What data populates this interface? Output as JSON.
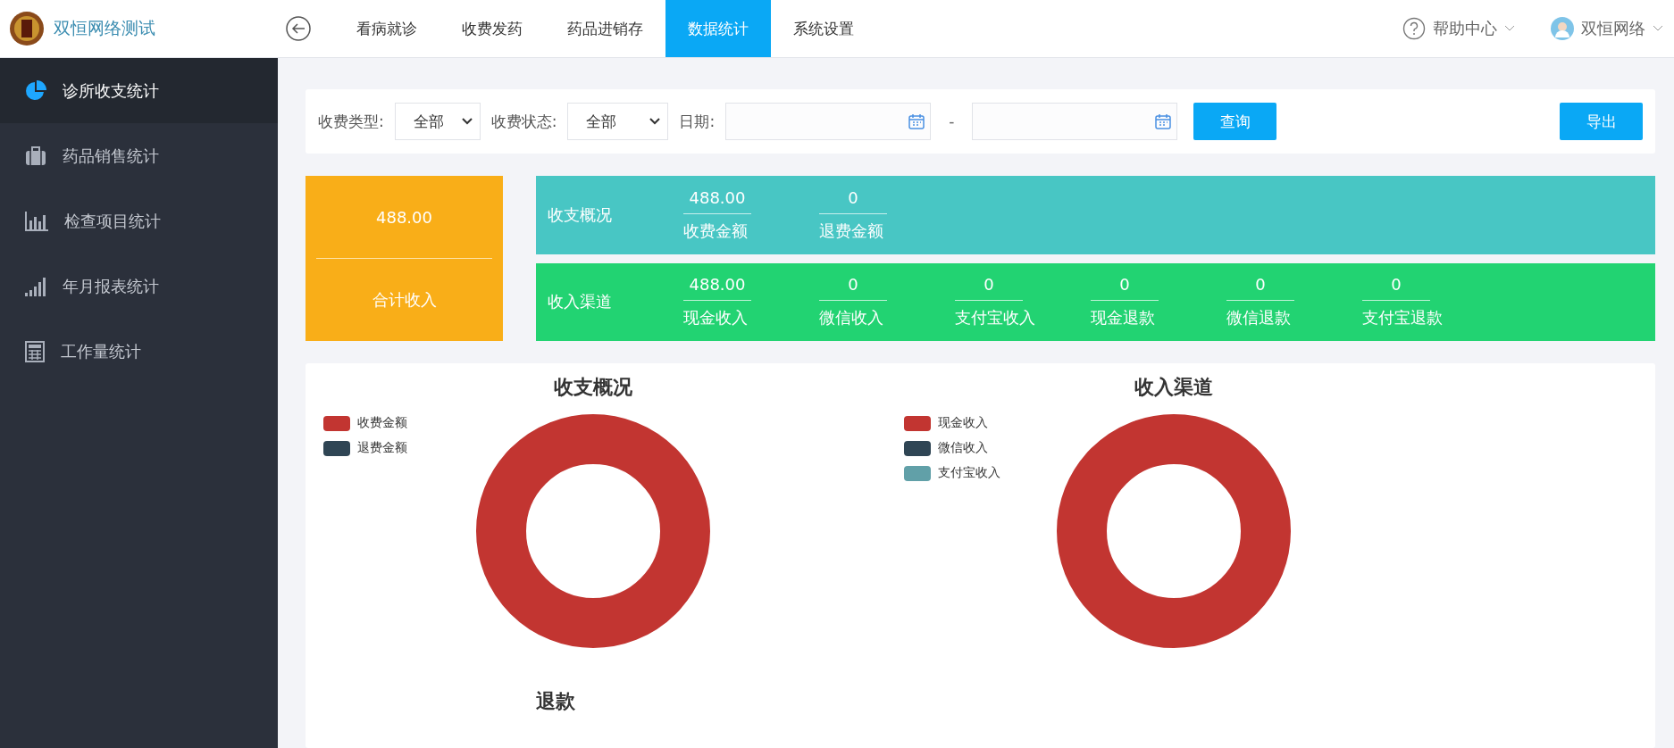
{
  "header": {
    "app_title": "双恒网络测试",
    "nav_tabs": [
      {
        "label": "看病就诊",
        "selected": false
      },
      {
        "label": "收费发药",
        "selected": false
      },
      {
        "label": "药品进销存",
        "selected": false
      },
      {
        "label": "数据统计",
        "selected": true
      },
      {
        "label": "系统设置",
        "selected": false
      }
    ],
    "help": "帮助中心",
    "user": "双恒网络"
  },
  "sidebar": {
    "items": [
      {
        "label": "诊所收支统计",
        "kind": "pie",
        "selected": true
      },
      {
        "label": "药品销售统计",
        "kind": "briefcase",
        "selected": false
      },
      {
        "label": "检查项目统计",
        "kind": "bars",
        "selected": false
      },
      {
        "label": "年月报表统计",
        "kind": "signal",
        "selected": false
      },
      {
        "label": "工作量统计",
        "kind": "calculator",
        "selected": false
      }
    ]
  },
  "filters": {
    "fee_type_label": "收费类型:",
    "fee_type_value": "全部",
    "fee_status_label": "收费状态:",
    "fee_status_value": "全部",
    "date_label": "日期:",
    "date_separator": "-",
    "query_button": "查询",
    "export_button": "导出"
  },
  "total": {
    "value": "488.00",
    "label": "合计收入"
  },
  "summary_rows": [
    {
      "title": "收支概况",
      "color": "#48c6c4",
      "items": [
        {
          "value": "488.00",
          "label": "收费金额"
        },
        {
          "value": "0",
          "label": "退费金额"
        }
      ]
    },
    {
      "title": "收入渠道",
      "color": "#22d372",
      "items": [
        {
          "value": "488.00",
          "label": "现金收入"
        },
        {
          "value": "0",
          "label": "微信收入"
        },
        {
          "value": "0",
          "label": "支付宝收入"
        },
        {
          "value": "0",
          "label": "现金退款"
        },
        {
          "value": "0",
          "label": "微信退款"
        },
        {
          "value": "0",
          "label": "支付宝退款"
        }
      ]
    }
  ],
  "charts": [
    {
      "title": "收支概况",
      "legend": [
        {
          "label": "收费金额",
          "color": "#c23531"
        },
        {
          "label": "退费金额",
          "color": "#2f4554"
        }
      ]
    },
    {
      "title": "收入渠道",
      "legend": [
        {
          "label": "现金收入",
          "color": "#c23531"
        },
        {
          "label": "微信收入",
          "color": "#2f4554"
        },
        {
          "label": "支付宝收入",
          "color": "#61a0a8"
        }
      ]
    }
  ],
  "bottom_chart_title": "退款"
}
